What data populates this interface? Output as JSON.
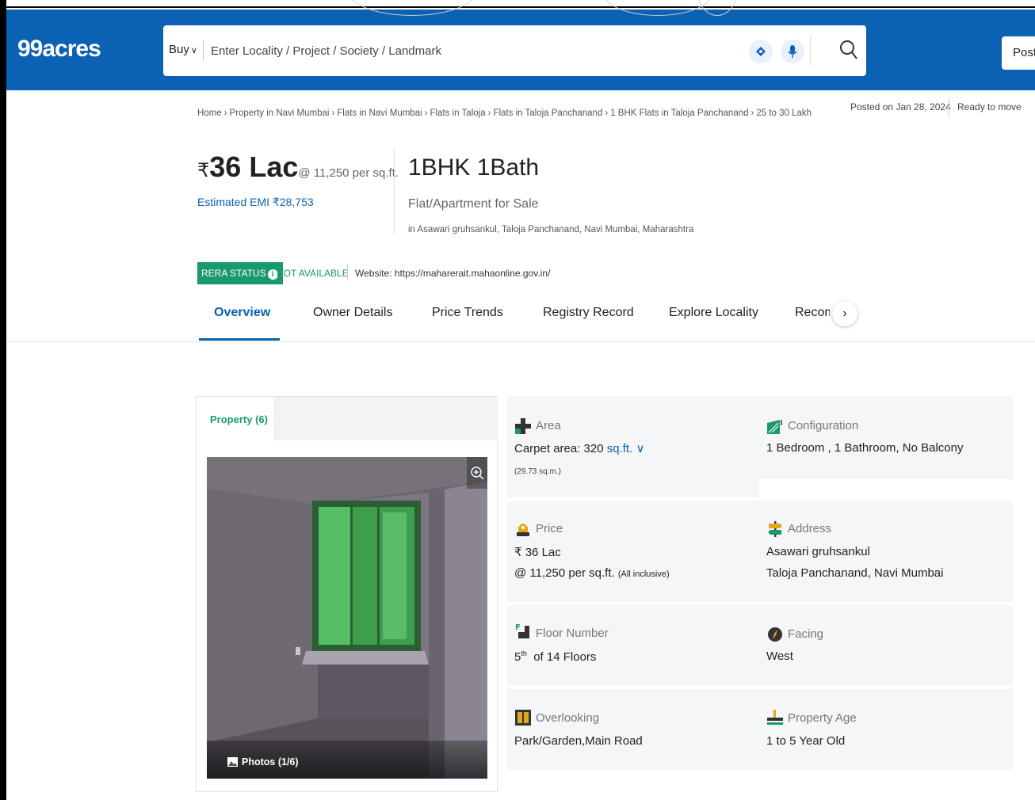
{
  "header": {
    "logo": "99acres",
    "buy_label": "Buy",
    "search_placeholder": "Enter Locality / Project / Society / Landmark",
    "post_label": "Post"
  },
  "breadcrumb": [
    "Home",
    "Property in Navi Mumbai",
    "Flats in Navi Mumbai",
    "Flats in Taloja",
    "Flats in Taloja Panchanand",
    "1 BHK Flats in Taloja Panchanand",
    "25 to 30 Lakh"
  ],
  "meta": {
    "posted": "Posted on Jan 28, 2024",
    "status": "Ready to move"
  },
  "summary": {
    "rupee": "₹",
    "price": "36 Lac",
    "per_sqft": "@ 11,250 per sq.ft.",
    "emi": "Estimated EMI ₹28,753",
    "bhk": "1BHK 1Bath",
    "type": "Flat/Apartment for Sale",
    "location": "in Asawari gruhsankul, Taloja Panchanand, Navi Mumbai, Maharashtra"
  },
  "rera": {
    "badge": "RERA STATUS",
    "info_icon": "i",
    "status": "NOT AVAILABLE",
    "website": "Website: https://maharerait.mahaonline.gov.in/"
  },
  "tabs": [
    {
      "label": "Overview",
      "active": true
    },
    {
      "label": "Owner Details",
      "active": false
    },
    {
      "label": "Price Trends",
      "active": false
    },
    {
      "label": "Registry Record",
      "active": false
    },
    {
      "label": "Explore Locality",
      "active": false
    },
    {
      "label": "Recommendations",
      "active": false
    }
  ],
  "tab_next": "›",
  "photos": {
    "tab_label": "Property (6)",
    "count_label": "Photos (1/6)"
  },
  "details": {
    "area": {
      "label": "Area",
      "value": "Carpet area: 320",
      "unit": "sq.ft.",
      "unit_chev": "∨",
      "sub": "(29.73 sq.m.)"
    },
    "configuration": {
      "label": "Configuration",
      "value": "1 Bedroom , 1 Bathroom, No Balcony"
    },
    "price": {
      "label": "Price",
      "value": "₹ 36 Lac",
      "value2": "@ 11,250 per sq.ft.",
      "note": "(All inclusive)"
    },
    "address": {
      "label": "Address",
      "line1": "Asawari gruhsankul",
      "line2": "Taloja Panchanand, Navi Mumbai"
    },
    "floor": {
      "label": "Floor Number",
      "floor": "5",
      "suffix": "th",
      "value": "of 14 Floors"
    },
    "facing": {
      "label": "Facing",
      "value": "West"
    },
    "overlooking": {
      "label": "Overlooking",
      "value": "Park/Garden,Main Road"
    },
    "age": {
      "label": "Property Age",
      "value": "1 to 5 Year Old"
    }
  },
  "colors": {
    "brand_blue": "#0b61b3",
    "rera_green": "#1a9a6c",
    "detail_bg": "#f5f6f8"
  }
}
